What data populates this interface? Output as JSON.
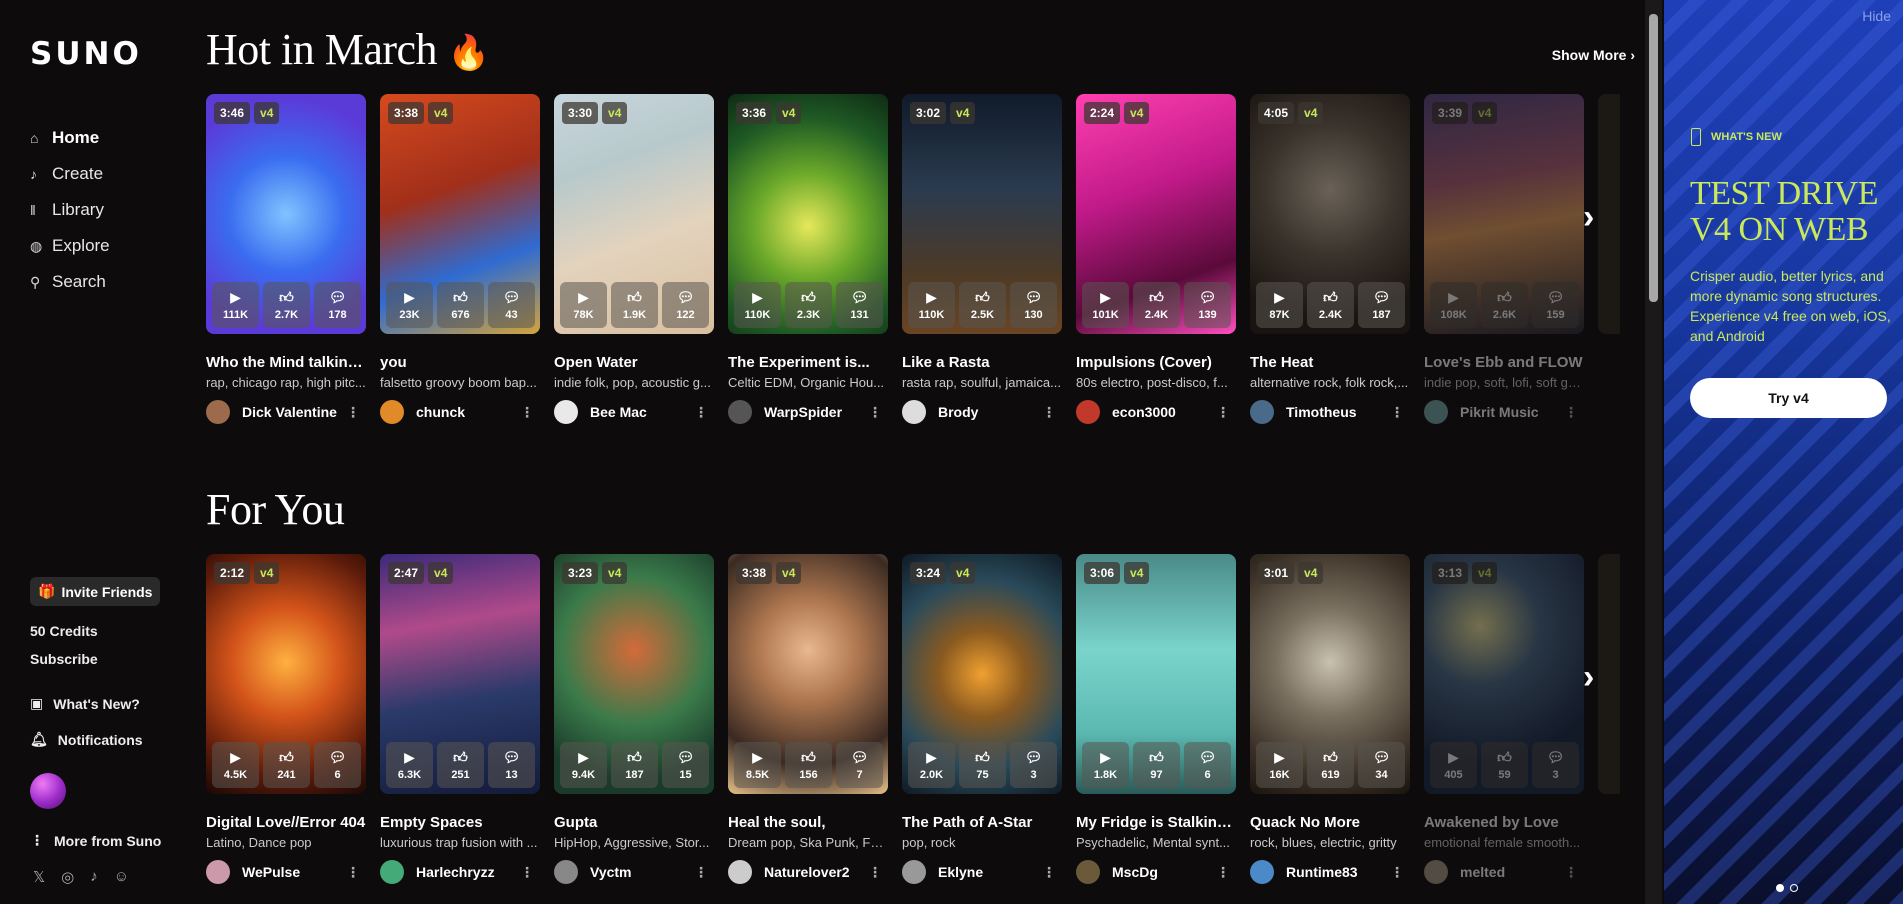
{
  "app": {
    "logo": "SUNO"
  },
  "nav": [
    {
      "label": "Home",
      "icon": "home-icon",
      "glyph": "⌂"
    },
    {
      "label": "Create",
      "icon": "music-note-icon",
      "glyph": "♪"
    },
    {
      "label": "Library",
      "icon": "library-icon",
      "glyph": "‖"
    },
    {
      "label": "Explore",
      "icon": "compass-icon",
      "glyph": "◍"
    },
    {
      "label": "Search",
      "icon": "search-icon",
      "glyph": "⚲"
    }
  ],
  "sidebar_footer": {
    "invite": "Invite Friends",
    "credits": "50 Credits",
    "subscribe": "Subscribe",
    "whats_new": "What's New?",
    "notifications": "Notifications",
    "more": "More from Suno"
  },
  "sections": [
    {
      "title": "Hot in March",
      "show_more": "Show More",
      "cards": [
        {
          "duration": "3:46",
          "version": "v4",
          "plays": "111K",
          "likes": "2.7K",
          "comments": "178",
          "title": "Who the Mind talking...",
          "tags": "rap, chicago rap, high pitc...",
          "author": "Dick Valentine",
          "bg": "radial-gradient(circle at 50% 50%, #7fc4ff 0%, #3a6cf0 40%, #5b3bd8 80%)",
          "av": "#9b6b4c"
        },
        {
          "duration": "3:38",
          "version": "v4",
          "plays": "23K",
          "likes": "676",
          "comments": "43",
          "title": "you",
          "tags": "falsetto groovy boom bap...",
          "author": "chunck",
          "bg": "linear-gradient(160deg, #d64a1e 0%, #a12f1a 40%, #2f6bd1 70%, #d4a43a 100%)",
          "av": "#e08a2a"
        },
        {
          "duration": "3:30",
          "version": "v4",
          "plays": "78K",
          "likes": "1.9K",
          "comments": "122",
          "title": "Open Water",
          "tags": "indie folk, pop, acoustic g...",
          "author": "Bee Mac",
          "bg": "linear-gradient(160deg, #c7d6dc 0%, #b8c9cc 30%, #e3d3bd 60%, #d9bfa0 100%)",
          "av": "#e9e9e9"
        },
        {
          "duration": "3:36",
          "version": "v4",
          "plays": "110K",
          "likes": "2.3K",
          "comments": "131",
          "title": "The Experiment is...",
          "tags": "Celtic EDM, Organic Hou...",
          "author": "WarpSpider",
          "bg": "radial-gradient(circle at 50% 55%, #e6e85a 0%, #6aa82a 35%, #1f5a24 70%, #0e2a14 100%)",
          "av": "#555"
        },
        {
          "duration": "3:02",
          "version": "v4",
          "plays": "110K",
          "likes": "2.5K",
          "comments": "130",
          "title": "Like a Rasta",
          "tags": "rasta rap, soulful, jamaica...",
          "author": "Brody",
          "bg": "linear-gradient(180deg, #101a2a 0%, #2b3b4f 40%, #4d3a26 75%, #6a4524 100%)",
          "av": "#ddd"
        },
        {
          "duration": "2:24",
          "version": "v4",
          "plays": "101K",
          "likes": "2.4K",
          "comments": "139",
          "title": "Impulsions (Cover)",
          "tags": "80s electro, post-disco, f...",
          "author": "econ3000",
          "bg": "linear-gradient(160deg, #ff3fb0 0%, #c21a8a 40%, #5a0a3a 75%, #ff4fc0 100%)",
          "av": "#c0392b"
        },
        {
          "duration": "4:05",
          "version": "v4",
          "plays": "87K",
          "likes": "2.4K",
          "comments": "187",
          "title": "The Heat",
          "tags": "alternative rock, folk rock,...",
          "author": "Timotheus",
          "bg": "radial-gradient(circle at 50% 40%, #6a6258 0%, #3a332c 40%, #1a1410 80%)",
          "av": "#4a6a8a"
        },
        {
          "duration": "3:39",
          "version": "v4",
          "plays": "108K",
          "likes": "2.6K",
          "comments": "159",
          "title": "Love's Ebb and FLOW",
          "tags": "indie pop, soft, lofi, soft gu...",
          "author": "Pikrit Music",
          "bg": "linear-gradient(170deg, #5a4a8a 0%, #b0607a 35%, #e8a060 55%, #2a2a3a 100%)",
          "av": "#7aa",
          "faded": true
        }
      ]
    },
    {
      "title": "For You",
      "cards": [
        {
          "duration": "2:12",
          "version": "v4",
          "plays": "4.5K",
          "likes": "241",
          "comments": "6",
          "title": "Digital Love//Error 404",
          "tags": "Latino, Dance pop",
          "author": "WePulse",
          "bg": "radial-gradient(circle at 50% 45%, #ffb040 0%, #d4541a 35%, #5a1a0a 75%, #1a0805 100%)",
          "av": "#c9a"
        },
        {
          "duration": "2:47",
          "version": "v4",
          "plays": "6.3K",
          "likes": "251",
          "comments": "13",
          "title": "Empty Spaces",
          "tags": "luxurious trap fusion with ...",
          "author": "Harlechryzz",
          "bg": "linear-gradient(170deg, #3a2a7a 0%, #b04a8a 30%, #2a3a6a 60%, #141a3a 100%)",
          "av": "#4a7"
        },
        {
          "duration": "3:23",
          "version": "v4",
          "plays": "9.4K",
          "likes": "187",
          "comments": "15",
          "title": "Gupta",
          "tags": "HipHop, Aggressive, Stor...",
          "author": "Vyctm",
          "bg": "radial-gradient(circle at 50% 40%, #d46a3a 0%, #3a7a4a 45%, #1a3a2a 80%)",
          "av": "#888"
        },
        {
          "duration": "3:38",
          "version": "v4",
          "plays": "8.5K",
          "likes": "156",
          "comments": "7",
          "title": "Heal the soul,",
          "tags": "Dream pop, Ska Punk, Fol...",
          "author": "Naturelover2",
          "bg": "radial-gradient(circle at 50% 40%, #e8b890 0%, #b07850 30%, #3a2a22 70%, #e8c08a 100%)",
          "av": "#ccc"
        },
        {
          "duration": "3:24",
          "version": "v4",
          "plays": "2.0K",
          "likes": "75",
          "comments": "3",
          "title": "The Path of A-Star",
          "tags": "pop, rock",
          "author": "Eklyne",
          "bg": "radial-gradient(circle at 50% 50%, #f0a030 0%, #8a5a20 30%, #2a4a5a 65%, #0e1a24 100%)",
          "av": "#999"
        },
        {
          "duration": "3:06",
          "version": "v4",
          "plays": "1.8K",
          "likes": "97",
          "comments": "6",
          "title": "My Fridge is Stalking...",
          "tags": "Psychadelic, Mental synt...",
          "author": "MscDg",
          "bg": "linear-gradient(180deg, #4a8a88 0%, #7ad4cc 40%, #5ab8b0 75%, #2a5a58 100%)",
          "av": "#6a5a3a"
        },
        {
          "duration": "3:01",
          "version": "v4",
          "plays": "16K",
          "likes": "619",
          "comments": "34",
          "title": "Quack No More",
          "tags": "rock, blues, electric, gritty",
          "author": "Runtime83",
          "bg": "radial-gradient(circle at 50% 45%, #c8c0b0 0%, #7a7060 35%, #3a3026 75%, #1a140e 100%)",
          "av": "#4a8ac8"
        },
        {
          "duration": "3:13",
          "version": "v4",
          "plays": "405",
          "likes": "59",
          "comments": "3",
          "title": "Awakened by Love",
          "tags": "emotional female smooth...",
          "author": "melted",
          "bg": "radial-gradient(circle at 35% 30%, #f0e8a0 0%, #4a6a8a 30%, #1a2a4a 70%)",
          "av": "#a98",
          "faded": true
        }
      ]
    }
  ],
  "promo": {
    "hide": "Hide",
    "whats_new": "WHAT'S NEW",
    "title_line1": "TEST DRIVE",
    "title_line2": "V4 ON WEB",
    "text": "Crisper audio, better lyrics, and more dynamic song structures. Experience v4 free on web, iOS, and Android",
    "button": "Try v4"
  }
}
